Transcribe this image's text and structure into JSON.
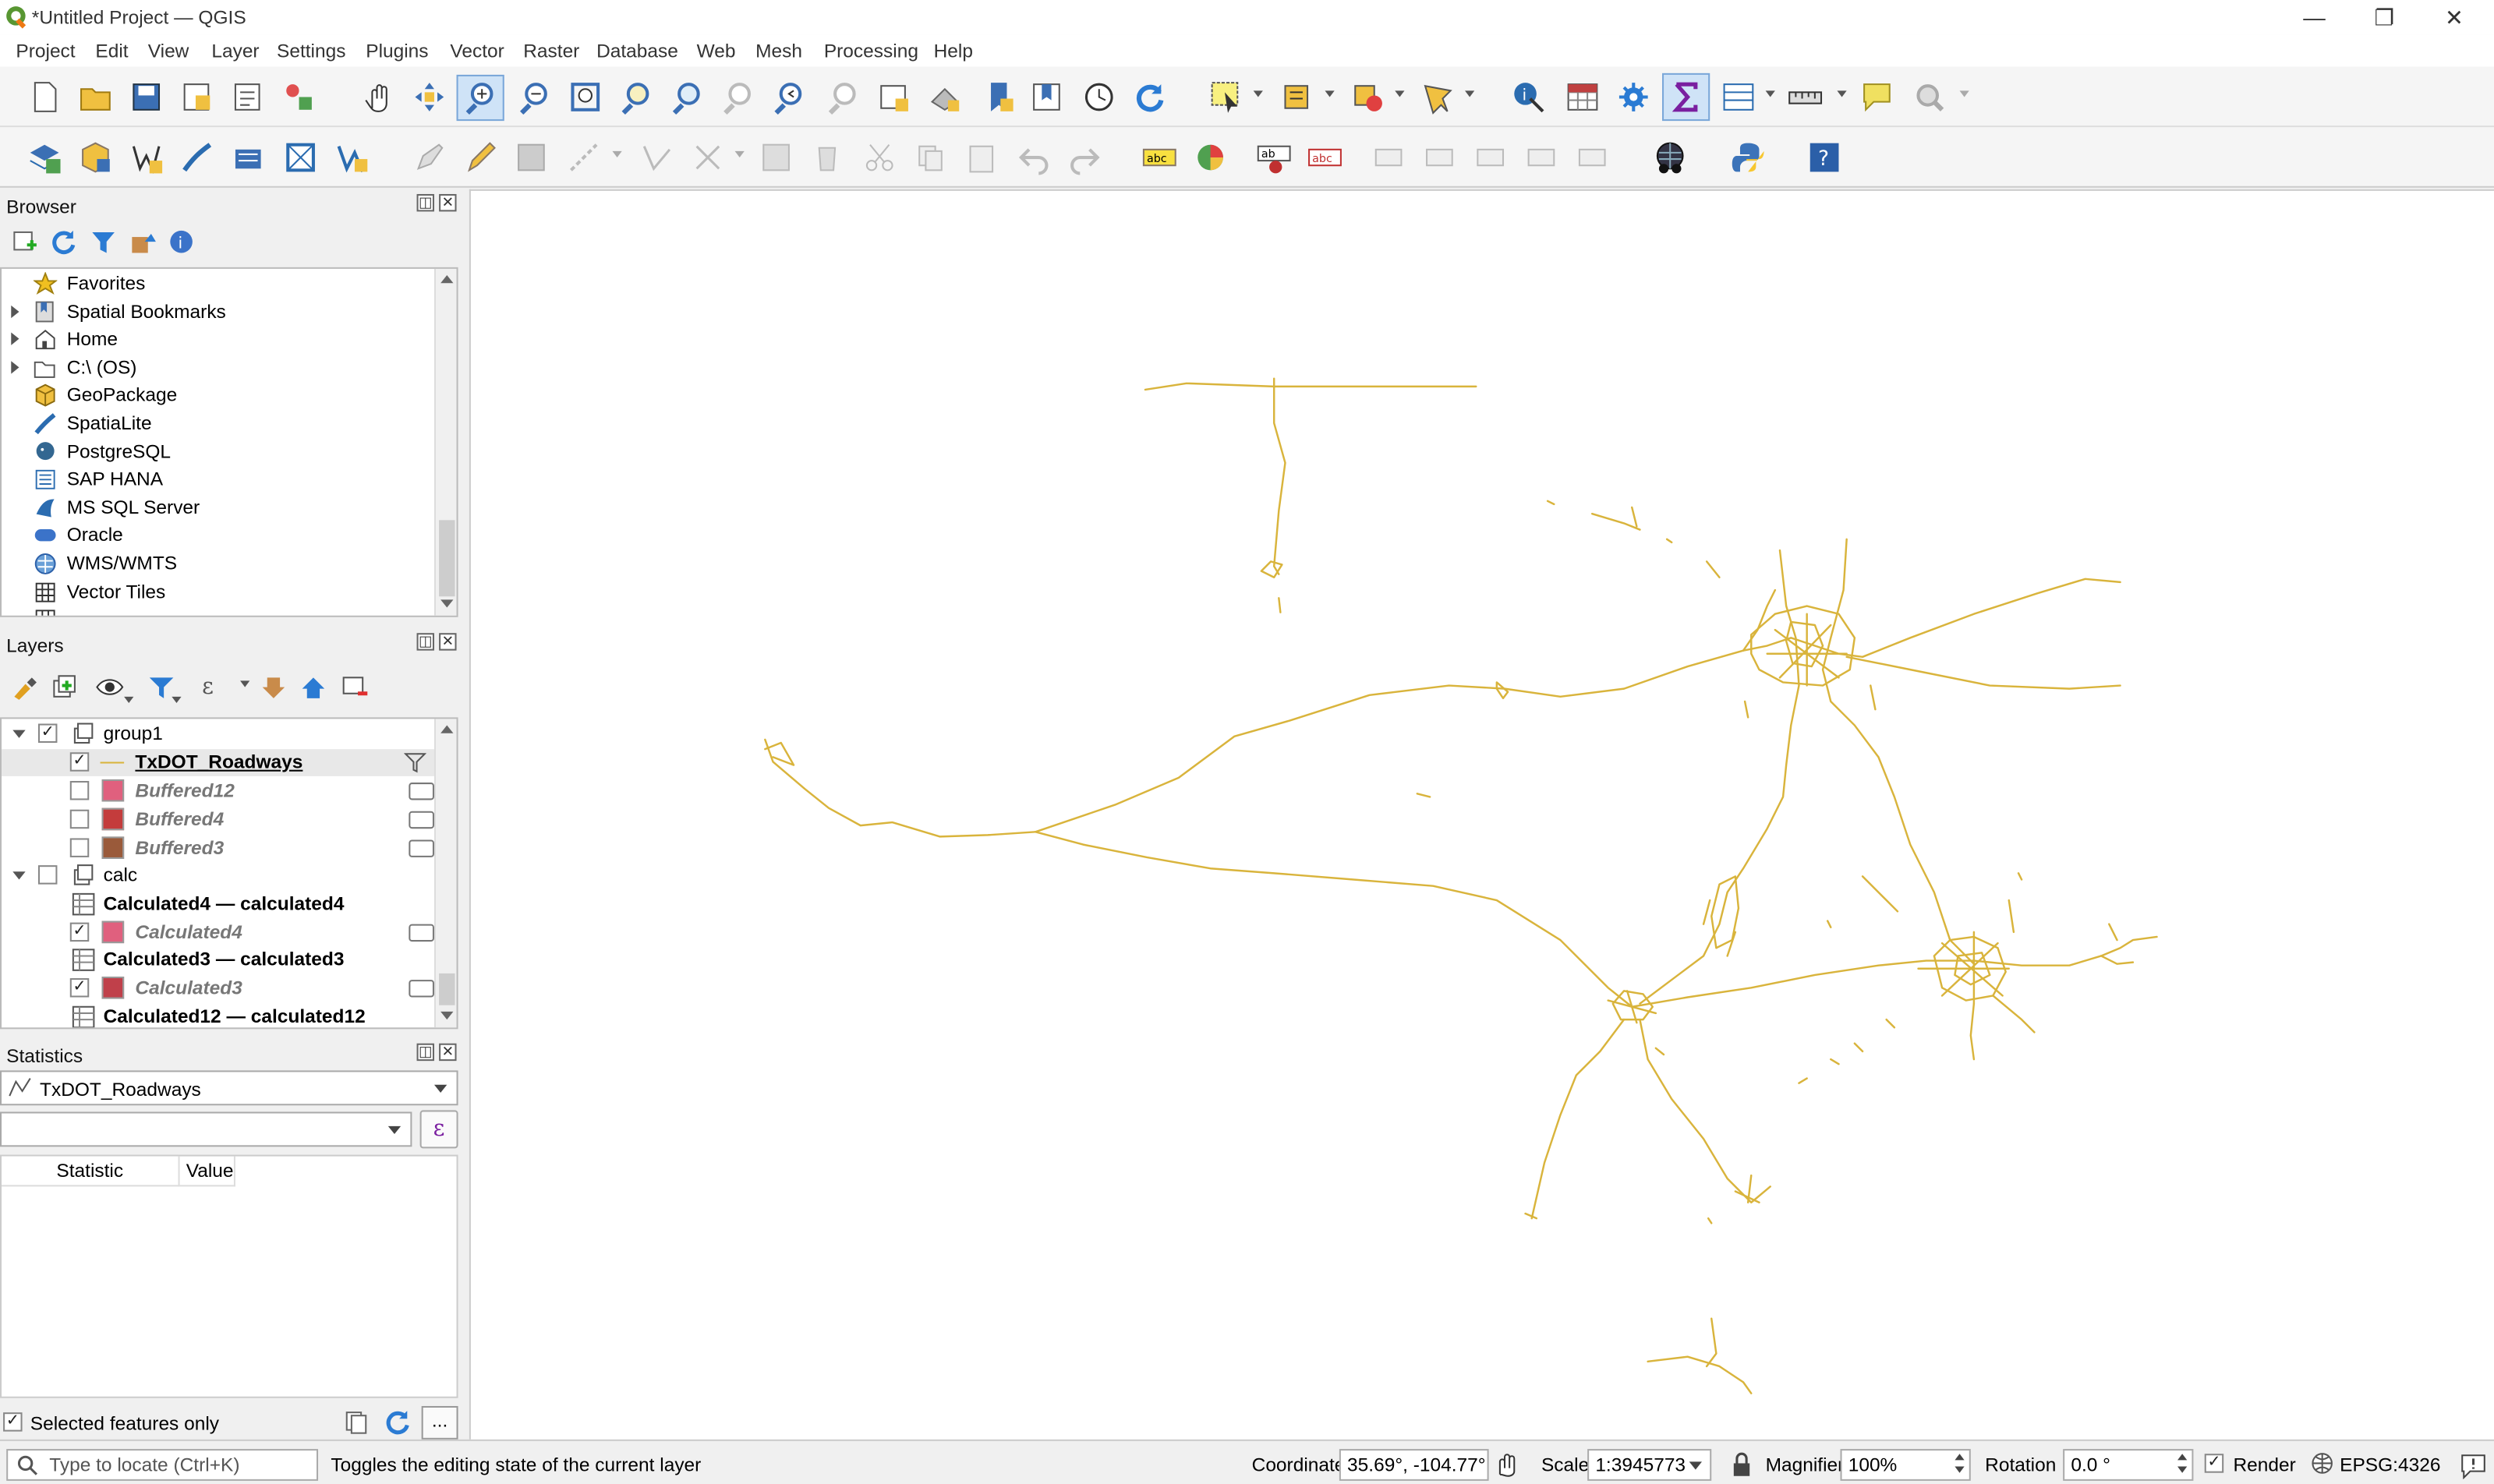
{
  "window": {
    "title": "*Untitled Project — QGIS",
    "minimize": "—",
    "maximize": "❐",
    "close": "✕"
  },
  "menu": [
    "Project",
    "Edit",
    "View",
    "Layer",
    "Settings",
    "Plugins",
    "Vector",
    "Raster",
    "Database",
    "Web",
    "Mesh",
    "Processing",
    "Help"
  ],
  "browser": {
    "title": "Browser",
    "items": [
      {
        "label": "Favorites",
        "expandable": false,
        "icon": "star-icon"
      },
      {
        "label": "Spatial Bookmarks",
        "expandable": true,
        "icon": "bookmark-icon"
      },
      {
        "label": "Home",
        "expandable": true,
        "icon": "home-icon"
      },
      {
        "label": "C:\\ (OS)",
        "expandable": true,
        "icon": "folder-icon"
      },
      {
        "label": "GeoPackage",
        "expandable": false,
        "icon": "geopackage-icon"
      },
      {
        "label": "SpatiaLite",
        "expandable": false,
        "icon": "spatialite-icon"
      },
      {
        "label": "PostgreSQL",
        "expandable": false,
        "icon": "postgresql-icon"
      },
      {
        "label": "SAP HANA",
        "expandable": false,
        "icon": "sap-hana-icon"
      },
      {
        "label": "MS SQL Server",
        "expandable": false,
        "icon": "mssql-icon"
      },
      {
        "label": "Oracle",
        "expandable": false,
        "icon": "oracle-icon"
      },
      {
        "label": "WMS/WMTS",
        "expandable": false,
        "icon": "globe-icon"
      },
      {
        "label": "Vector Tiles",
        "expandable": false,
        "icon": "grid-icon"
      }
    ]
  },
  "layers": {
    "title": "Layers",
    "group1": {
      "label": "group1"
    },
    "txdot": {
      "label": "TxDOT_Roadways"
    },
    "buffered12": {
      "label": "Buffered12",
      "color": "#e0607e"
    },
    "buffered4": {
      "label": "Buffered4",
      "color": "#c43c3c"
    },
    "buffered3": {
      "label": "Buffered3",
      "color": "#9a5a3a"
    },
    "calc": {
      "label": "calc"
    },
    "calc4table": {
      "label": "Calculated4 — calculated4"
    },
    "calc4": {
      "label": "Calculated4",
      "color": "#e0607e"
    },
    "calc3table": {
      "label": "Calculated3 — calculated3"
    },
    "calc3": {
      "label": "Calculated3",
      "color": "#c0404a"
    },
    "calc12table": {
      "label": "Calculated12 — calculated12"
    }
  },
  "statistics": {
    "title": "Statistics",
    "layer_select": "TxDOT_Roadways",
    "field_select": "",
    "col_statistic": "Statistic",
    "col_value": "Value",
    "selected_only": "Selected features only",
    "more_button": "..."
  },
  "status": {
    "locate_placeholder": "Type to locate (Ctrl+K)",
    "message": "Toggles the editing state of the current layer",
    "coordinate_label": "Coordinate",
    "coordinate": "35.69°, -104.77°",
    "scale_label": "Scale",
    "scale": "1:3945773",
    "magnifier_label": "Magnifier",
    "magnifier": "100%",
    "rotation_label": "Rotation",
    "rotation": "0.0 °",
    "render_label": "Render",
    "crs": "EPSG:4326"
  },
  "colors": {
    "roads": "#d9b43c",
    "accent": "#2b7bd3"
  }
}
